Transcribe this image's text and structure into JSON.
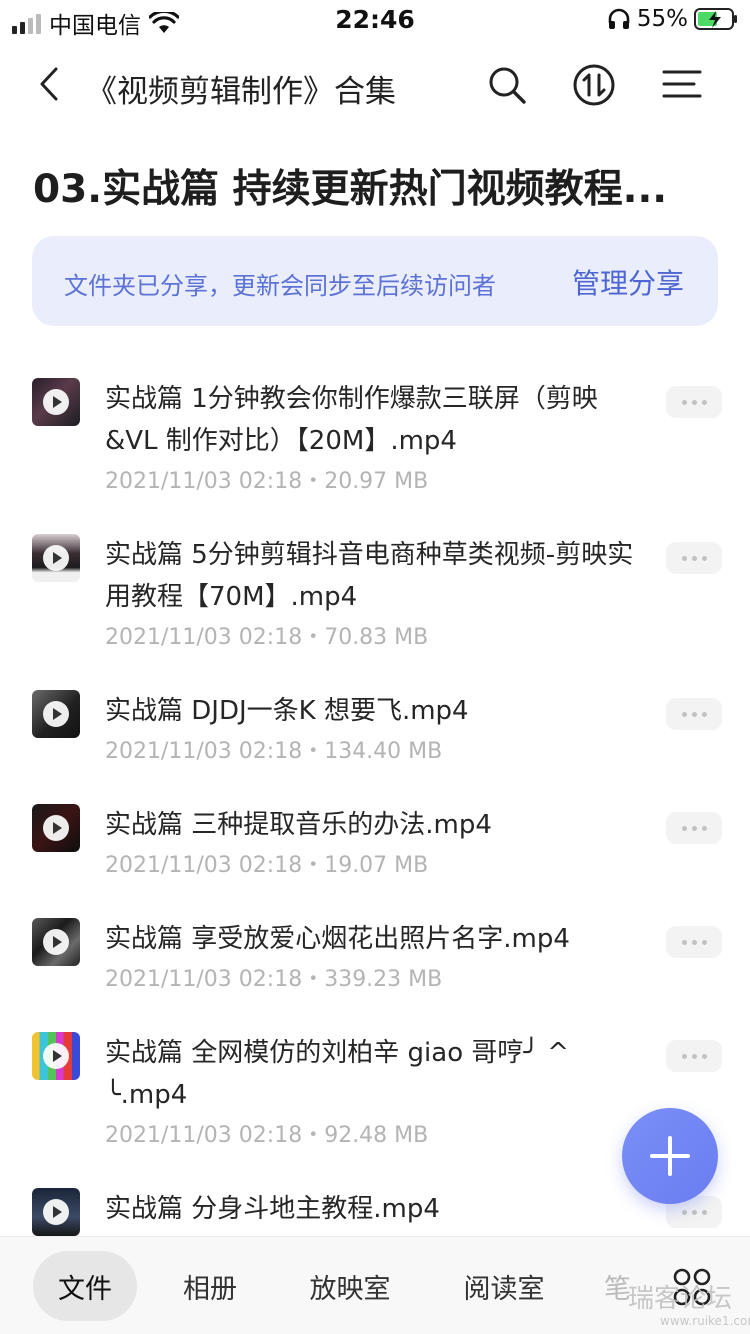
{
  "status_bar": {
    "carrier": "中国电信",
    "time": "22:46",
    "battery": "55%"
  },
  "nav": {
    "title": "《视频剪辑制作》合集",
    "icons": [
      "back-icon",
      "search-icon",
      "sort-icon",
      "menu-icon"
    ]
  },
  "folder": {
    "title": "03.实战篇 持续更新热门视频教程..."
  },
  "share": {
    "notice": "文件夹已分享，更新会同步至后续访问者",
    "manage_label": "管理分享"
  },
  "files": [
    {
      "name": "实战篇 1分钟教会你制作爆款三联屏（剪映&VL 制作对比）【20M】.mp4",
      "meta": "2021/11/03 02:18・20.97 MB"
    },
    {
      "name": "实战篇 5分钟剪辑抖音电商种草类视频-剪映实用教程【70M】.mp4",
      "meta": "2021/11/03 02:18・70.83 MB"
    },
    {
      "name": "实战篇 DJDJ一条K 想要飞.mp4",
      "meta": "2021/11/03 02:18・134.40 MB"
    },
    {
      "name": "实战篇 三种提取音乐的办法.mp4",
      "meta": "2021/11/03 02:18・19.07 MB"
    },
    {
      "name": "实战篇 享受放爱心烟花出照片名字.mp4",
      "meta": "2021/11/03 02:18・339.23 MB"
    },
    {
      "name": "实战篇 全网模仿的刘柏辛 giao 哥哼╯ ^ ╰.mp4",
      "meta": "2021/11/03 02:18・92.48 MB"
    },
    {
      "name": "实战篇 分身斗地主教程.mp4",
      "meta": ""
    }
  ],
  "tabbar": {
    "tabs": [
      "文件",
      "相册",
      "放映室",
      "阅读室",
      "笔"
    ],
    "active": "文件"
  },
  "watermark": {
    "text": "瑞客论坛",
    "sub": "www.ruike1.com"
  },
  "colors": {
    "accent": "#4d66d4",
    "banner_bg": "#eaedfb",
    "fab": "#7486f4",
    "battery": "#4cd964"
  }
}
